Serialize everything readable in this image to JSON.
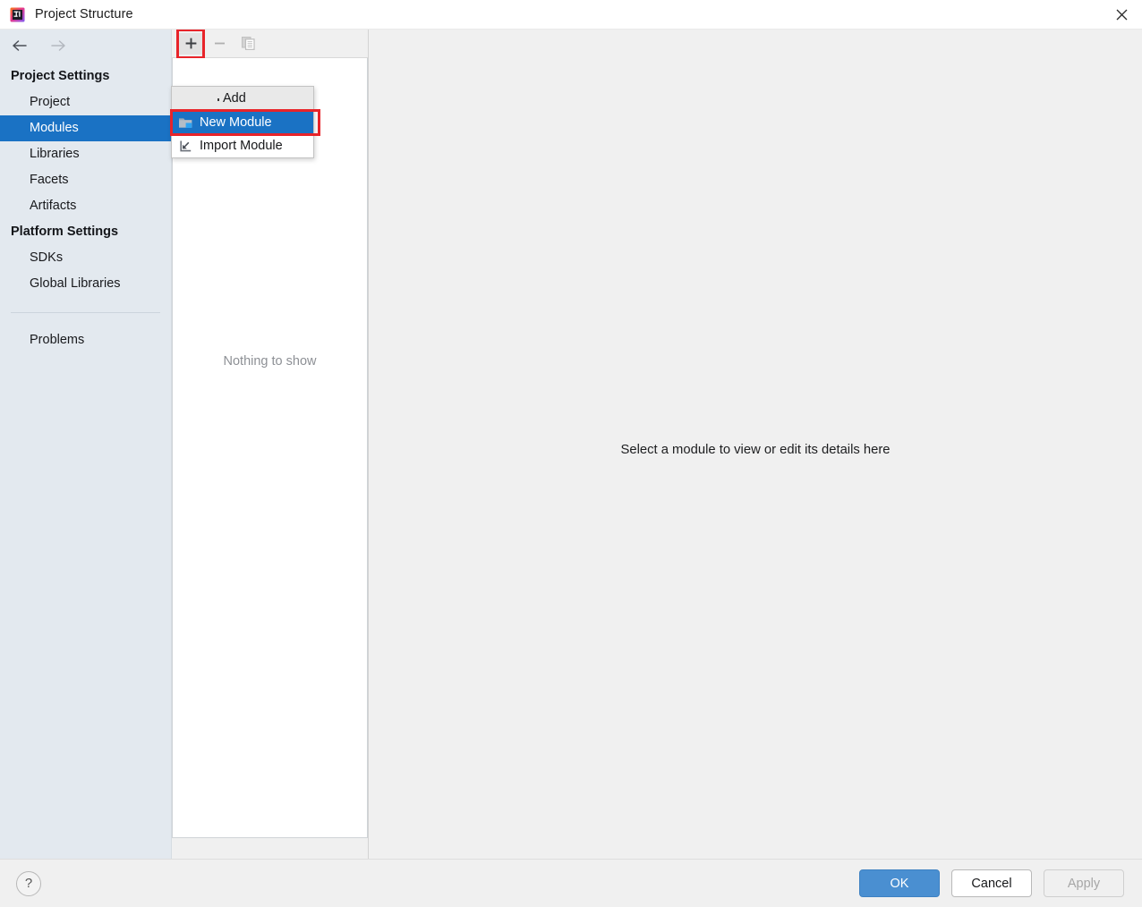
{
  "window": {
    "title": "Project Structure",
    "app_icon": "intellij-idea-icon",
    "close_icon": "close-icon"
  },
  "navigation": {
    "back_icon": "arrow-left-icon",
    "forward_icon": "arrow-right-icon"
  },
  "sidebar": {
    "groups": [
      {
        "label": "Project Settings",
        "items": [
          {
            "label": "Project",
            "selected": false
          },
          {
            "label": "Modules",
            "selected": true
          },
          {
            "label": "Libraries",
            "selected": false
          },
          {
            "label": "Facets",
            "selected": false
          },
          {
            "label": "Artifacts",
            "selected": false
          }
        ]
      },
      {
        "label": "Platform Settings",
        "items": [
          {
            "label": "SDKs",
            "selected": false
          },
          {
            "label": "Global Libraries",
            "selected": false
          }
        ]
      }
    ],
    "extra": {
      "label": "Problems"
    }
  },
  "toolbar": {
    "add": {
      "icon": "plus-icon",
      "label": "Add",
      "enabled": true,
      "highlighted": true
    },
    "remove": {
      "icon": "minus-icon",
      "label": "Remove",
      "enabled": false
    },
    "copy": {
      "icon": "copy-icon",
      "label": "Copy",
      "enabled": false
    }
  },
  "add_menu": {
    "header": "Add",
    "items": [
      {
        "label": "New Module",
        "icon": "folder-new-icon",
        "active": true,
        "highlighted": true
      },
      {
        "label": "Import Module",
        "icon": "import-icon",
        "active": false,
        "highlighted": false
      }
    ]
  },
  "module_list": {
    "empty_text": "Nothing to show"
  },
  "detail_panel": {
    "message": "Select a module to view or edit its details here"
  },
  "footer": {
    "help_label": "?",
    "ok_label": "OK",
    "cancel_label": "Cancel",
    "apply_label": "Apply"
  },
  "colors": {
    "accent_blue": "#1a72c4",
    "primary_button": "#4a8fd1",
    "highlight_red": "#e8242a",
    "sidebar_bg": "#e3e9ef",
    "panel_bg": "#f0f0f0"
  }
}
